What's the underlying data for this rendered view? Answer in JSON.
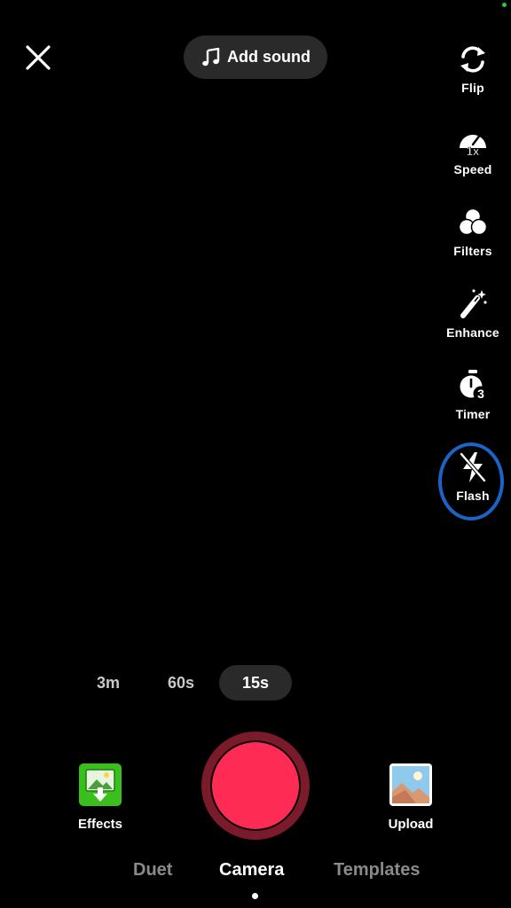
{
  "top": {
    "add_sound_label": "Add sound"
  },
  "rail": {
    "items": [
      {
        "label": "Flip",
        "icon": "flip-icon"
      },
      {
        "label": "Speed",
        "icon": "speed-icon",
        "badge": "1x"
      },
      {
        "label": "Filters",
        "icon": "filters-icon"
      },
      {
        "label": "Enhance",
        "icon": "enhance-icon"
      },
      {
        "label": "Timer",
        "icon": "timer-icon",
        "badge": "3"
      },
      {
        "label": "Flash",
        "icon": "flash-off-icon",
        "highlighted": true
      }
    ]
  },
  "durations": {
    "options": [
      "3m",
      "60s",
      "15s"
    ],
    "selected": "15s"
  },
  "bottom": {
    "effects_label": "Effects",
    "upload_label": "Upload"
  },
  "modes": {
    "items": [
      "Duet",
      "Camera",
      "Templates"
    ],
    "selected": "Camera"
  },
  "colors": {
    "record": "#fe2c55",
    "record_ring": "#7a1a2a",
    "highlight_ring": "#1b63c4",
    "effects_tile": "#3ac01c"
  }
}
